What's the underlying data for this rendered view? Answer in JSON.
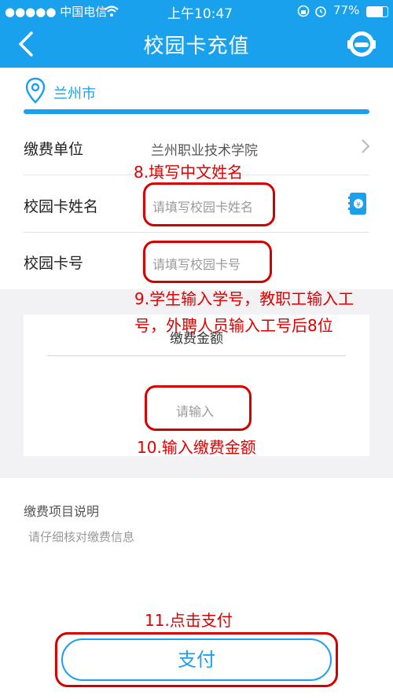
{
  "status_bar": {
    "carrier": "●●●●● 中国电信",
    "time": "上午10:47",
    "battery": "77%"
  },
  "nav": {
    "title": "校园卡充值",
    "back_icon": "chevron-left-icon",
    "service_icon": "customer-service-icon"
  },
  "location": {
    "city": "兰州市",
    "icon": "location-pin-icon"
  },
  "form": {
    "unit_label": "缴费单位",
    "unit_value": "兰州职业技术学院",
    "name_label": "校园卡姓名",
    "name_placeholder": "请填写校园卡姓名",
    "card_label": "校园卡号",
    "card_placeholder": "请填写校园卡号"
  },
  "amount": {
    "label": "缴费金额",
    "placeholder": "请输入"
  },
  "notes": {
    "title": "缴费项目说明",
    "text": "请仔细核对缴费信息"
  },
  "annotations": {
    "step8": "8.填写中文姓名",
    "step9_line1": "9.学生输入学号，教职工输入工",
    "step9_line2": "号，外聘人员输入工号后8位",
    "step10": "10.输入缴费金额",
    "step11": "11.点击支付"
  },
  "pay_button": "支付",
  "colors": {
    "brand": "#1aa1ee",
    "annotation": "#e00000"
  }
}
